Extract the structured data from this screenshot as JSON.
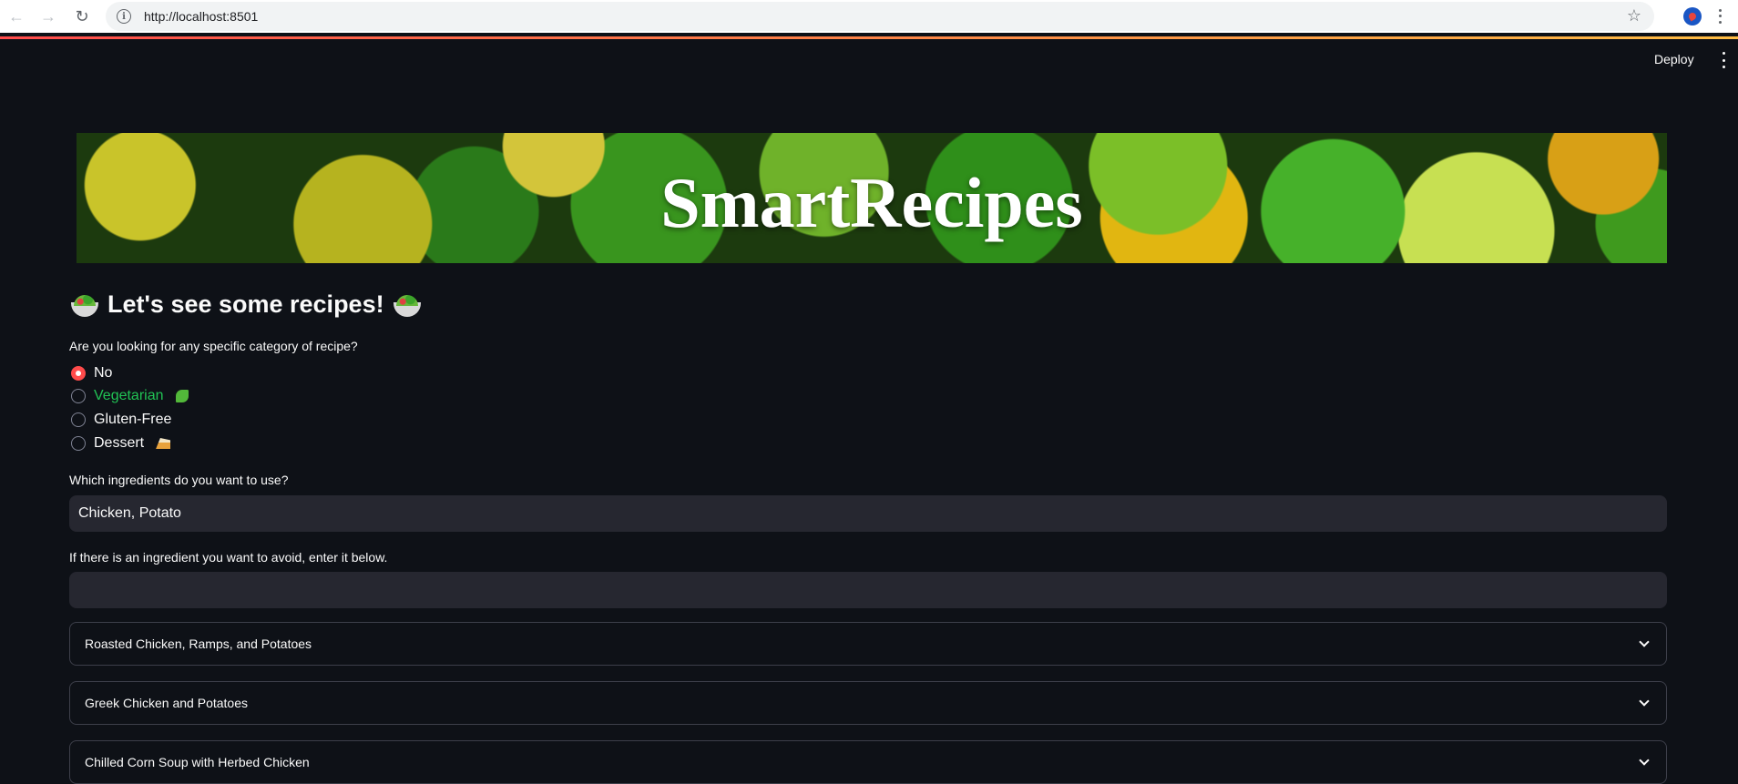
{
  "browser": {
    "url": "http://localhost:8501",
    "info_glyph": "i"
  },
  "header": {
    "deploy_label": "Deploy"
  },
  "banner": {
    "title": "SmartRecipes"
  },
  "main": {
    "heading": "Let's see some recipes!",
    "category_label": "Are you looking for any specific category of recipe?",
    "category_options": [
      {
        "label": "No",
        "selected": true
      },
      {
        "label": "Vegetarian",
        "selected": false,
        "color": "#21c354",
        "icon": "leaf-icon"
      },
      {
        "label": "Gluten-Free",
        "selected": false
      },
      {
        "label": "Dessert",
        "selected": false,
        "icon": "cake-icon"
      }
    ],
    "ingredients_label": "Which ingredients do you want to use?",
    "ingredients_value": "Chicken, Potato",
    "avoid_label": "If there is an ingredient you want to avoid, enter it below.",
    "avoid_value": "",
    "recipes": [
      {
        "title": "Roasted Chicken, Ramps, and Potatoes"
      },
      {
        "title": "Greek Chicken and Potatoes"
      },
      {
        "title": "Chilled Corn Soup with Herbed Chicken"
      }
    ]
  },
  "colors": {
    "background": "#0e1117",
    "accent": "#ff4b4b",
    "input_bg": "#262730",
    "vegetarian": "#21c354"
  }
}
